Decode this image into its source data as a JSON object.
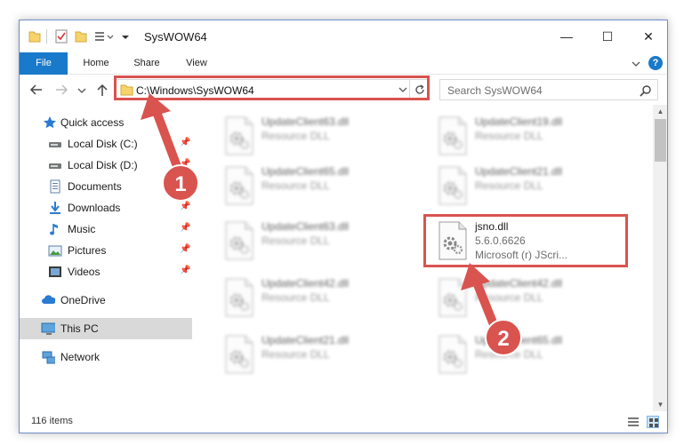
{
  "window": {
    "title": "SysWOW64",
    "minimize": "—",
    "maximize": "☐",
    "close": "✕"
  },
  "ribbon": {
    "tabs": [
      "File",
      "Home",
      "Share",
      "View"
    ],
    "help": "?"
  },
  "address": {
    "path": "C:\\Windows\\SysWOW64",
    "search_placeholder": "Search SysWOW64"
  },
  "nav_pane": {
    "items": [
      {
        "label": "Quick access",
        "icon": "star-icon",
        "pinned": false
      },
      {
        "label": "Local Disk (C:)",
        "icon": "drive-icon",
        "pinned": true
      },
      {
        "label": "Local Disk (D:)",
        "icon": "drive-icon",
        "pinned": true
      },
      {
        "label": "Documents",
        "icon": "documents-icon",
        "pinned": true
      },
      {
        "label": "Downloads",
        "icon": "download-icon",
        "pinned": true
      },
      {
        "label": "Music",
        "icon": "music-icon",
        "pinned": true
      },
      {
        "label": "Pictures",
        "icon": "pictures-icon",
        "pinned": true
      },
      {
        "label": "Videos",
        "icon": "videos-icon",
        "pinned": true
      },
      {
        "label": "OneDrive",
        "icon": "cloud-icon",
        "pinned": false
      },
      {
        "label": "This PC",
        "icon": "computer-icon",
        "pinned": false,
        "selected": true
      },
      {
        "label": "Network",
        "icon": "network-icon",
        "pinned": false
      }
    ]
  },
  "files": [
    {
      "name": "UpdateClient63.dll",
      "desc": "Resource DLL",
      "blurred": true
    },
    {
      "name": "UpdateClient19.dll",
      "desc": "Resource DLL",
      "blurred": true
    },
    {
      "name": "UpdateClient65.dll",
      "desc": "Resource DLL",
      "blurred": true
    },
    {
      "name": "UpdateClient21.dll",
      "desc": "Resource DLL",
      "blurred": true
    },
    {
      "name": "UpdateClient63.dll",
      "desc": "Resource DLL",
      "blurred": true
    },
    {
      "name": "jsno.dll",
      "desc": "5.6.0.6626",
      "extra": "Microsoft (r) JScri...",
      "blurred": false
    },
    {
      "name": "UpdateClient42.dll",
      "desc": "Resource DLL",
      "blurred": true
    },
    {
      "name": "UpdateClient42.dll",
      "desc": "Resource DLL",
      "blurred": true
    },
    {
      "name": "UpdateClient21.dll",
      "desc": "Resource DLL",
      "blurred": true
    },
    {
      "name": "UpdateClient65.dll",
      "desc": "Resource DLL",
      "blurred": true
    }
  ],
  "status": {
    "count": "116 items"
  },
  "annotations": [
    {
      "number": "1"
    },
    {
      "number": "2"
    }
  ],
  "colors": {
    "accent": "#1979ca",
    "annotation_red": "#d9534f",
    "selected_bg": "#d9d9d9"
  }
}
